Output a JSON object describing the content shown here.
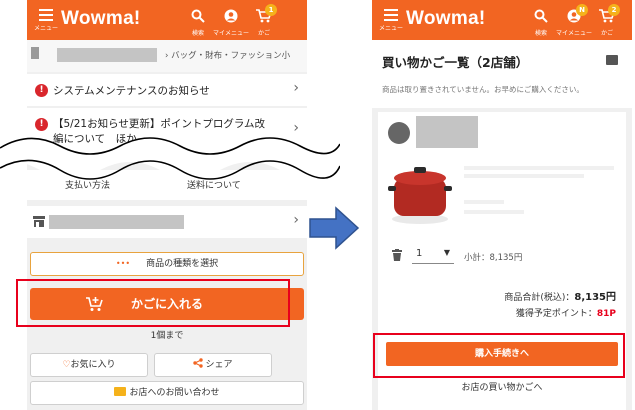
{
  "left": {
    "header": {
      "menu_label": "メニュー",
      "logo": "Wowma!",
      "search_label": "検索",
      "mymenu_label": "マイメニュー",
      "cart_label": "かご",
      "cart_badge": "1"
    },
    "breadcrumb": "› バッグ・財布・ファッション小",
    "notices": [
      "システムメンテナンスのお知らせ",
      "【5/21お知らせ更新】ポイントプログラム改",
      "編について　ほか"
    ],
    "links": {
      "payment": "支払い方法",
      "shipping": "送料について"
    },
    "select_type_label": "商品の種類を選択",
    "select_type_dots": "•••",
    "add_to_cart_label": "かごに入れる",
    "limit_text": "1個まで",
    "favorite_label": "お気に入り",
    "share_label": "シェア",
    "contact_label": "お店へのお問い合わせ"
  },
  "right": {
    "header": {
      "menu_label": "メニュー",
      "logo": "Wowma!",
      "search_label": "検索",
      "mymenu_label": "マイメニュー",
      "mymenu_badge": "N",
      "cart_label": "かご",
      "cart_badge": "2"
    },
    "title": "買い物かご一覧（2店舗）",
    "subtitle": "商品は取り置きされていません。お早めにご購入ください。",
    "quantity": "1",
    "subtotal": "小計：8,135円",
    "total_label": "商品合計(税込)：",
    "total_value": "8,135円",
    "points_label": "獲得予定ポイント：",
    "points_value": "81P",
    "checkout_label": "購入手続きへ",
    "shop_cart_label": "お店の買い物かごへ"
  },
  "colors": {
    "brand": "#f26522",
    "highlight": "#e8001c",
    "arrow": "#4472c4",
    "badge": "#f5b21b",
    "warning": "#d9262c"
  }
}
